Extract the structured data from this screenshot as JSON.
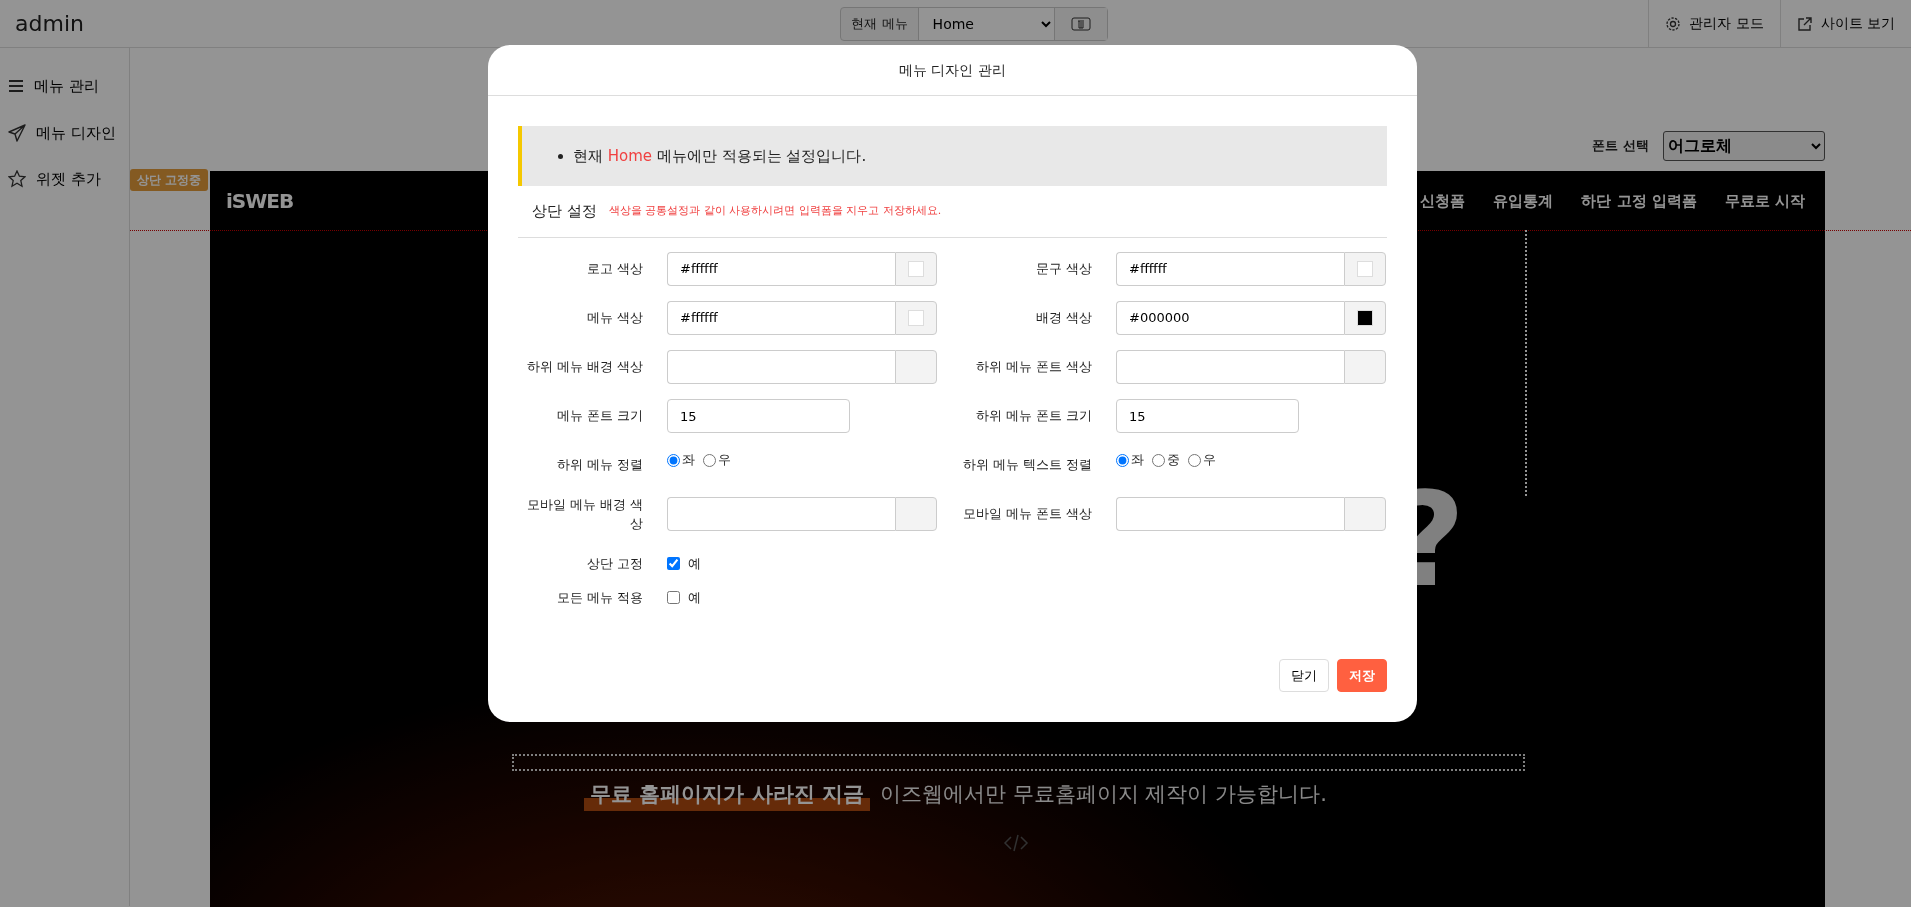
{
  "topbar": {
    "title": "admin",
    "current_menu": {
      "label": "현재 메뉴",
      "value": "Home"
    },
    "actions": [
      {
        "kind": "gear",
        "label": "관리자 모드"
      },
      {
        "kind": "external",
        "label": "사이트 보기"
      }
    ]
  },
  "sidebar": {
    "items": [
      {
        "kind": "menu",
        "label": "메뉴 관리"
      },
      {
        "kind": "send",
        "label": "메뉴 디자인"
      },
      {
        "kind": "star",
        "label": "위젯 추가"
      }
    ]
  },
  "font_select": {
    "label": "폰트 선택",
    "value": "어그로체"
  },
  "preview": {
    "badge": "상단 고정중",
    "logo": "iSWEB",
    "nav": [
      "신청폼",
      "유입통계",
      "하단 고정 입력폼",
      "무료로 시작"
    ],
    "glyph": "?",
    "tagline_highlight": "무료 홈페이지가 사라진 지금",
    "tagline": "이즈웹에서만 무료홈페이지 제작이 가능합니다."
  },
  "modal": {
    "title": "메뉴 디자인 관리",
    "notice": {
      "before": "현재 ",
      "menu": "Home",
      "after": " 메뉴에만 적용되는 설정입니다."
    },
    "section": {
      "title": "상단 설정",
      "hint": "색상을 공통설정과 같이 사용하시려면 입력폼을 지우고 저장하세요."
    },
    "rows": [
      {
        "left": {
          "kind": "color",
          "label": "로고 색상",
          "value": "#ffffff",
          "color": "#ffffff"
        },
        "right": {
          "kind": "color",
          "label": "문구 색상",
          "value": "#ffffff",
          "color": "#ffffff"
        }
      },
      {
        "left": {
          "kind": "color",
          "label": "메뉴 색상",
          "value": "#ffffff",
          "color": "#ffffff"
        },
        "right": {
          "kind": "color",
          "label": "배경 색상",
          "value": "#000000",
          "color": "#000000"
        }
      },
      {
        "left": {
          "kind": "color",
          "label": "하위 메뉴 배경 색상"
        },
        "right": {
          "kind": "color",
          "label": "하위 메뉴 폰트 색상"
        }
      },
      {
        "left": {
          "kind": "number",
          "label": "메뉴 폰트 크기",
          "value": "15"
        },
        "right": {
          "kind": "number",
          "label": "하위 메뉴 폰트 크기",
          "value": "15"
        }
      },
      {
        "left": {
          "kind": "radio",
          "label": "하위 메뉴 정렬",
          "options": [
            {
              "label": "좌",
              "selected": true
            },
            {
              "label": "우",
              "selected": false
            }
          ]
        },
        "right": {
          "kind": "radio",
          "label": "하위 메뉴 텍스트 정렬",
          "options": [
            {
              "label": "좌",
              "selected": true
            },
            {
              "label": "중",
              "selected": false
            },
            {
              "label": "우",
              "selected": false
            }
          ]
        }
      },
      {
        "left": {
          "kind": "color",
          "label": "모바일 메뉴 배경 색상"
        },
        "right": {
          "kind": "color",
          "label": "모바일 메뉴 폰트 색상"
        }
      },
      {
        "left": {
          "kind": "checkbox",
          "label": "상단 고정",
          "option": "예",
          "checked": true
        }
      },
      {
        "left": {
          "kind": "checkbox",
          "label": "모든 메뉴 적용",
          "option": "예",
          "checked": false
        }
      }
    ],
    "buttons": [
      {
        "kind": "secondary",
        "label": "닫기"
      },
      {
        "kind": "primary",
        "label": "저장"
      }
    ]
  }
}
